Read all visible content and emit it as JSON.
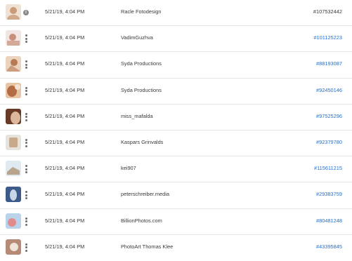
{
  "rows": [
    {
      "date": "5/21/19, 4:04 PM",
      "creator": "Racle Fotodesign",
      "id": "#107532442",
      "menu_icon": "info-icon",
      "thumb": [
        "#efe2d4",
        "#c99b78"
      ]
    },
    {
      "date": "5/21/19, 4:04 PM",
      "creator": "VadimGuzhva",
      "id": "#101125223",
      "menu_icon": "more-vertical-icon",
      "thumb": [
        "#f1e6e3",
        "#c98f7a"
      ]
    },
    {
      "date": "5/21/19, 4:04 PM",
      "creator": "Syda Productions",
      "id": "#88193087",
      "menu_icon": "more-vertical-icon",
      "thumb": [
        "#ecd3bd",
        "#b77a55"
      ]
    },
    {
      "date": "5/21/19, 4:04 PM",
      "creator": "Syda Productions",
      "id": "#92450146",
      "menu_icon": "more-vertical-icon",
      "thumb": [
        "#e7c4a6",
        "#b36b46"
      ]
    },
    {
      "date": "5/21/19, 4:04 PM",
      "creator": "miss_mafalda",
      "id": "#97525296",
      "menu_icon": "more-vertical-icon",
      "thumb": [
        "#6b3a26",
        "#dcb79a"
      ]
    },
    {
      "date": "5/21/19, 4:04 PM",
      "creator": "Kaspars Grinvalds",
      "id": "#92379780",
      "menu_icon": "more-vertical-icon",
      "thumb": [
        "#e6e2dc",
        "#c8a98c"
      ]
    },
    {
      "date": "5/21/19, 4:04 PM",
      "creator": "kei907",
      "id": "#115611215",
      "menu_icon": "more-vertical-icon",
      "thumb": [
        "#dfe9f0",
        "#b9a58c"
      ]
    },
    {
      "date": "5/21/19, 4:04 PM",
      "creator": "peterschreiber.media",
      "id": "#29383759",
      "menu_icon": "more-vertical-icon",
      "thumb": [
        "#3c5a8a",
        "#c8d6e6"
      ]
    },
    {
      "date": "5/21/19, 4:04 PM",
      "creator": "BillionPhotos.com",
      "id": "#80481248",
      "menu_icon": "more-vertical-icon",
      "thumb": [
        "#b9d4ea",
        "#e08c8c"
      ]
    },
    {
      "date": "5/21/19, 4:04 PM",
      "creator": "PhotoArt Thomas Klee",
      "id": "#43395845",
      "menu_icon": "more-vertical-icon",
      "thumb": [
        "#b58a76",
        "#f0e3da"
      ]
    }
  ]
}
